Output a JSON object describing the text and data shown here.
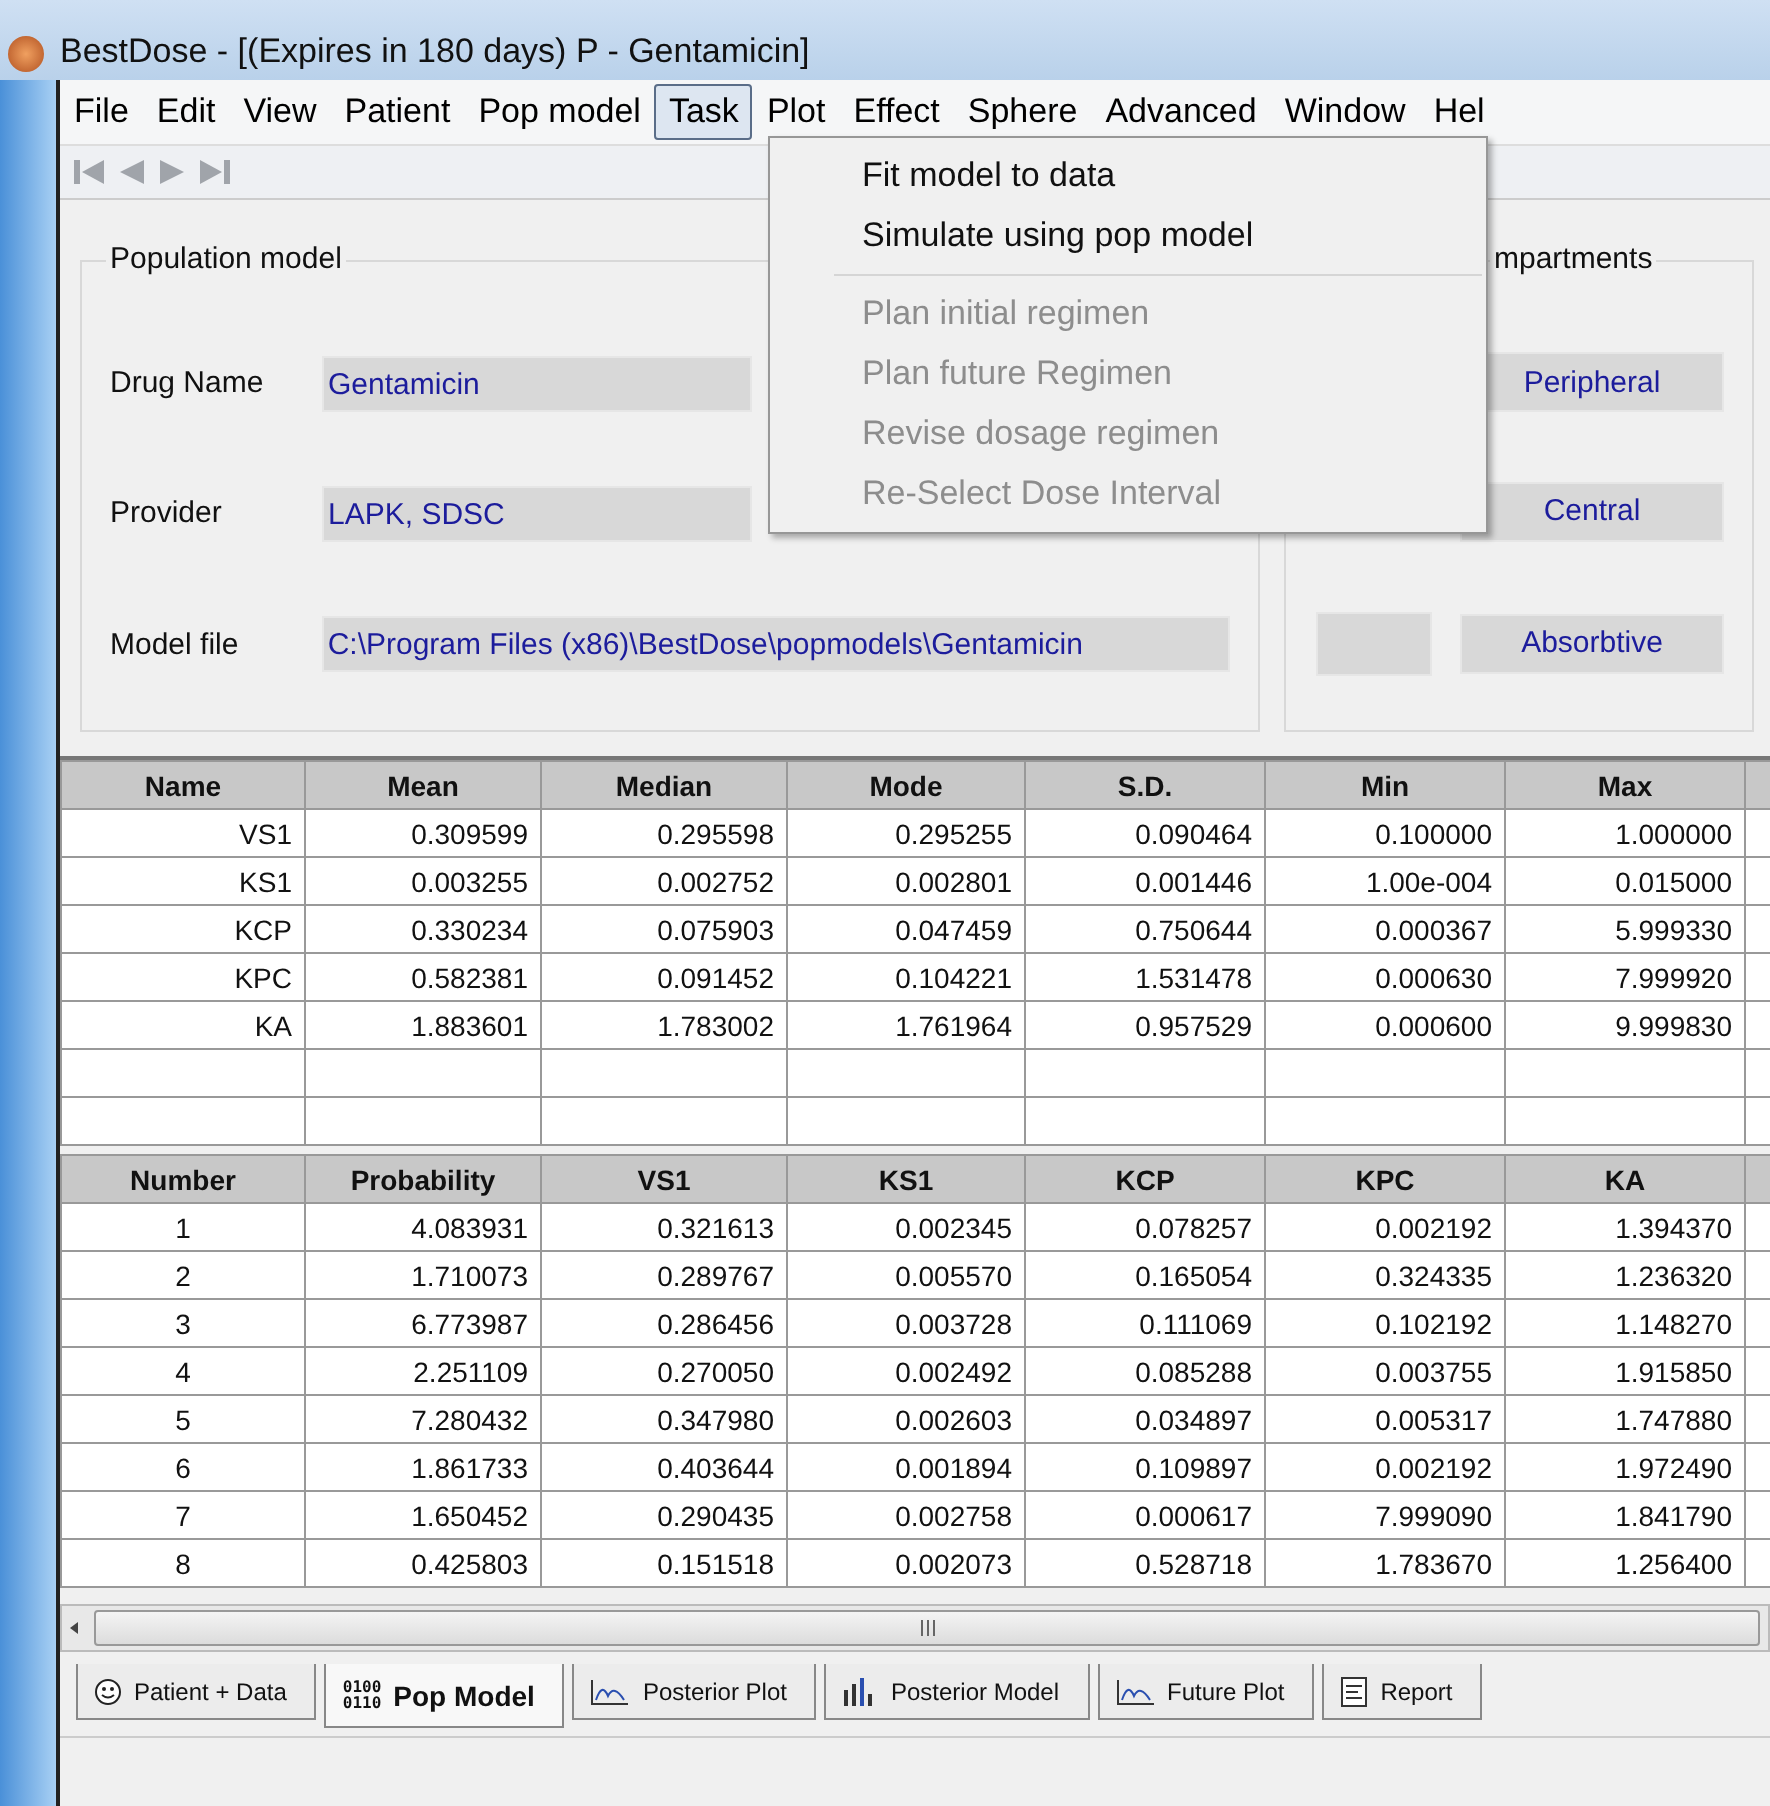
{
  "window": {
    "title": "BestDose - [(Expires in 180 days) P - Gentamicin]"
  },
  "menu_bar": [
    {
      "label": "File",
      "selected": false
    },
    {
      "label": "Edit",
      "selected": false
    },
    {
      "label": "View",
      "selected": false
    },
    {
      "label": "Patient",
      "selected": false
    },
    {
      "label": "Pop model",
      "selected": false
    },
    {
      "label": "Task",
      "selected": true
    },
    {
      "label": "Plot",
      "selected": false
    },
    {
      "label": "Effect",
      "selected": false
    },
    {
      "label": "Sphere",
      "selected": false
    },
    {
      "label": "Advanced",
      "selected": false
    },
    {
      "label": "Window",
      "selected": false
    },
    {
      "label": "Hel",
      "selected": false
    }
  ],
  "task_menu": [
    {
      "label": "Fit model to data",
      "disabled": false,
      "separator_after": false
    },
    {
      "label": "Simulate using pop model",
      "disabled": false,
      "separator_after": true
    },
    {
      "label": "Plan initial regimen",
      "disabled": true,
      "separator_after": false
    },
    {
      "label": "Plan future Regimen",
      "disabled": true,
      "separator_after": false
    },
    {
      "label": "Revise dosage regimen",
      "disabled": true,
      "separator_after": false
    },
    {
      "label": "Re-Select Dose Interval",
      "disabled": true,
      "separator_after": false
    }
  ],
  "population_model": {
    "title": "Population model",
    "fields": [
      {
        "label": "Drug Name",
        "value": "Gentamicin",
        "wide": false
      },
      {
        "label": "Provider",
        "value": "LAPK, SDSC",
        "wide": false
      },
      {
        "label": "Model file",
        "value": "C:\\Program Files (x86)\\BestDose\\popmodels\\Gentamicin",
        "wide": true
      }
    ]
  },
  "compartments": {
    "title": "mpartments",
    "items": [
      {
        "label": "Peripheral",
        "field": false
      },
      {
        "label": "Central",
        "field": false
      },
      {
        "label": "Absorbtive",
        "field": true
      }
    ]
  },
  "stats_table": {
    "columns": [
      "Name",
      "Mean",
      "Median",
      "Mode",
      "S.D.",
      "Min",
      "Max"
    ],
    "rows": [
      [
        "VS1",
        "0.309599",
        "0.295598",
        "0.295255",
        "0.090464",
        "0.100000",
        "1.000000"
      ],
      [
        "KS1",
        "0.003255",
        "0.002752",
        "0.002801",
        "0.001446",
        "1.00e-004",
        "0.015000"
      ],
      [
        "KCP",
        "0.330234",
        "0.075903",
        "0.047459",
        "0.750644",
        "0.000367",
        "5.999330"
      ],
      [
        "KPC",
        "0.582381",
        "0.091452",
        "0.104221",
        "1.531478",
        "0.000630",
        "7.999920"
      ],
      [
        "KA",
        "1.883601",
        "1.783002",
        "1.761964",
        "0.957529",
        "0.000600",
        "9.999830"
      ]
    ]
  },
  "support_table": {
    "columns": [
      "Number",
      "Probability",
      "VS1",
      "KS1",
      "KCP",
      "KPC",
      "KA"
    ],
    "rows": [
      [
        "1",
        "4.083931",
        "0.321613",
        "0.002345",
        "0.078257",
        "0.002192",
        "1.394370"
      ],
      [
        "2",
        "1.710073",
        "0.289767",
        "0.005570",
        "0.165054",
        "0.324335",
        "1.236320"
      ],
      [
        "3",
        "6.773987",
        "0.286456",
        "0.003728",
        "0.111069",
        "0.102192",
        "1.148270"
      ],
      [
        "4",
        "2.251109",
        "0.270050",
        "0.002492",
        "0.085288",
        "0.003755",
        "1.915850"
      ],
      [
        "5",
        "7.280432",
        "0.347980",
        "0.002603",
        "0.034897",
        "0.005317",
        "1.747880"
      ],
      [
        "6",
        "1.861733",
        "0.403644",
        "0.001894",
        "0.109897",
        "0.002192",
        "1.972490"
      ],
      [
        "7",
        "1.650452",
        "0.290435",
        "0.002758",
        "0.000617",
        "7.999090",
        "1.841790"
      ],
      [
        "8",
        "0.425803",
        "0.151518",
        "0.002073",
        "0.528718",
        "1.783670",
        "1.256400"
      ]
    ]
  },
  "bottom_tabs": [
    {
      "label": "Patient + Data",
      "kind": "face",
      "selected": false
    },
    {
      "label": "Pop Model",
      "kind": "binary",
      "icon_text": [
        "0100",
        "0110"
      ],
      "selected": true
    },
    {
      "label": "Posterior Plot",
      "kind": "plot",
      "selected": false
    },
    {
      "label": "Posterior Model",
      "kind": "bars",
      "selected": false
    },
    {
      "label": "Future Plot",
      "kind": "plot",
      "selected": false
    },
    {
      "label": "Report",
      "kind": "doc",
      "selected": false
    }
  ]
}
